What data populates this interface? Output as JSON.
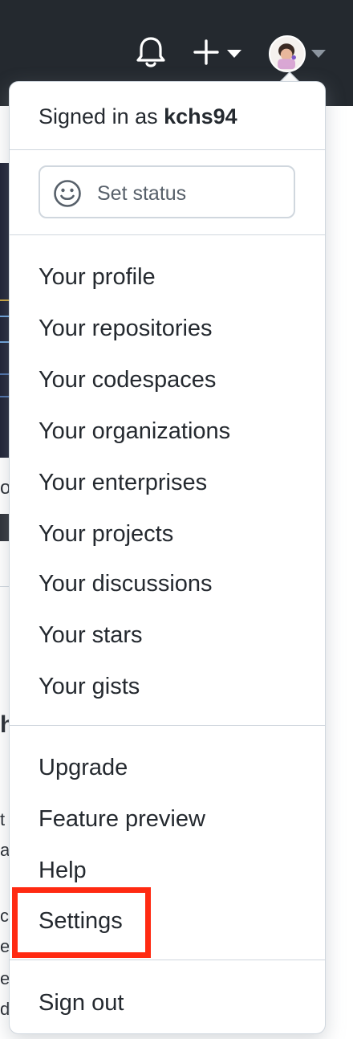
{
  "header": {
    "notifications_icon": "bell-icon",
    "create_icon": "plus-icon",
    "caret_icon": "triangle-down-icon",
    "avatar_alt": "avatar"
  },
  "user_menu": {
    "signed_in_prefix": "Signed in as",
    "username": "kchs94",
    "status": {
      "icon": "smiley-icon",
      "label": "Set status"
    },
    "primary_items": [
      {
        "label": "Your profile"
      },
      {
        "label": "Your repositories"
      },
      {
        "label": "Your codespaces"
      },
      {
        "label": "Your organizations"
      },
      {
        "label": "Your enterprises"
      },
      {
        "label": "Your projects"
      },
      {
        "label": "Your discussions"
      },
      {
        "label": "Your stars"
      },
      {
        "label": "Your gists"
      }
    ],
    "secondary_items": [
      {
        "label": "Upgrade"
      },
      {
        "label": "Feature preview"
      },
      {
        "label": "Help"
      },
      {
        "label": "Settings",
        "highlighted": true
      }
    ],
    "sign_out": "Sign out"
  },
  "background_page": {
    "fragments": [
      "o",
      "h",
      "t",
      "a",
      "o",
      "c",
      "e",
      "e",
      "d"
    ]
  },
  "colors": {
    "header_bg": "#24292f",
    "border": "#d0d7de",
    "text": "#24292f",
    "muted": "#57606a",
    "highlight": "#ff2a12"
  }
}
